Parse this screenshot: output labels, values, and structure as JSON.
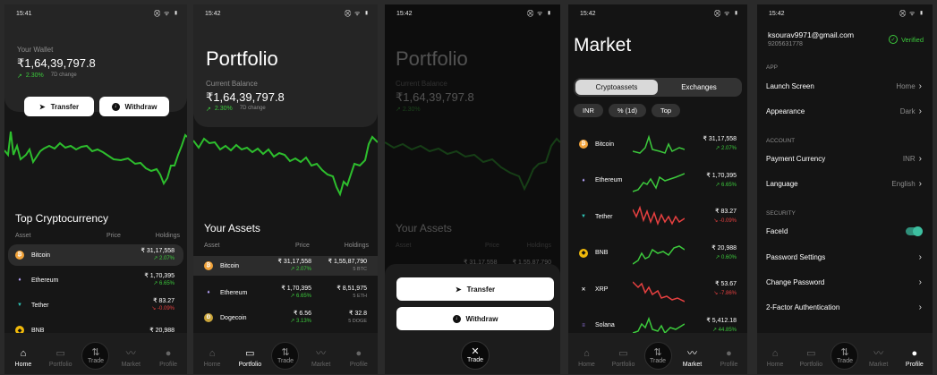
{
  "status_time": "15:42",
  "status_time_first": "15:41",
  "status_right": "⛒ ᯤ ▮",
  "nav": {
    "home": "Home",
    "portfolio": "Portfolio",
    "trade": "Trade",
    "market": "Market",
    "profile": "Profile"
  },
  "home": {
    "wallet_label": "Your Wallet",
    "wallet_value": "₹1,64,39,797.8",
    "wallet_change": "2.30%",
    "wallet_change_period": "7D change",
    "transfer": "Transfer",
    "withdraw": "Withdraw",
    "section_title": "Top Cryptocurrency",
    "col_asset": "Asset",
    "col_price": "Price",
    "col_holdings": "Holdings",
    "rows": [
      {
        "name": "Bitcoin",
        "price": "₹ 31,17,558",
        "change": "2.07%"
      },
      {
        "name": "Ethereum",
        "price": "₹ 1,70,395",
        "change": "6.65%"
      },
      {
        "name": "Tether",
        "price": "₹ 83.27",
        "change": "-0.09%"
      },
      {
        "name": "BNB",
        "price": "₹ 20,988",
        "change": ""
      }
    ]
  },
  "portfolio": {
    "title": "Portfolio",
    "balance_label": "Current Balance",
    "balance_value": "₹1,64,39,797.8",
    "change": "2.30%",
    "change_period": "7D change",
    "section_title": "Your Assets",
    "col_asset": "Asset",
    "col_price": "Price",
    "col_holdings": "Holdings",
    "rows": [
      {
        "name": "Bitcoin",
        "price": "₹ 31,17,558",
        "change": "2.07%",
        "holding": "₹ 1,55,87,790",
        "qty": "5 BTC"
      },
      {
        "name": "Ethereum",
        "price": "₹ 1,70,395",
        "change": "6.65%",
        "holding": "₹ 8,51,975",
        "qty": "5 ETH"
      },
      {
        "name": "Dogecoin",
        "price": "₹ 6.56",
        "change": "3.13%",
        "holding": "₹ 32.8",
        "qty": "5 DOGE"
      }
    ]
  },
  "overlay": {
    "title": "Portfolio",
    "balance_label": "Current Balance",
    "balance_value": "₹1,64,39,797.8",
    "change": "2.30%",
    "section_title": "Your Assets",
    "col_asset": "Asset",
    "col_price": "Price",
    "col_holdings": "Holdings",
    "row_price": "₹ 31,17,558",
    "row_holding": "₹ 1,55,87,790",
    "transfer": "Transfer",
    "withdraw": "Withdraw",
    "trade": "Trade"
  },
  "market": {
    "title": "Market",
    "tabs": [
      "Cryptoassets",
      "Exchanges"
    ],
    "filters": [
      "INR",
      "% (1d)",
      "Top"
    ],
    "rows": [
      {
        "name": "Bitcoin",
        "price": "₹ 31,17,558",
        "change": "2.07%",
        "dir": "up"
      },
      {
        "name": "Ethereum",
        "price": "₹ 1,70,395",
        "change": "6.65%",
        "dir": "up"
      },
      {
        "name": "Tether",
        "price": "₹ 83.27",
        "change": "-0.09%",
        "dir": "down"
      },
      {
        "name": "BNB",
        "price": "₹ 20,988",
        "change": "0.60%",
        "dir": "up"
      },
      {
        "name": "XRP",
        "price": "₹ 53.67",
        "change": "-7.86%",
        "dir": "down"
      },
      {
        "name": "Solana",
        "price": "₹ 5,412.18",
        "change": "44.85%",
        "dir": "up"
      }
    ]
  },
  "profile": {
    "email": "ksourav9971@gmail.com",
    "phone": "9205631778",
    "verified": "Verified",
    "sec_app": "APP",
    "sec_account": "ACCOUNT",
    "sec_security": "SECURITY",
    "launch_screen": "Launch Screen",
    "launch_screen_val": "Home",
    "appearance": "Appearance",
    "appearance_val": "Dark",
    "payment_currency": "Payment Currency",
    "payment_currency_val": "INR",
    "language": "Language",
    "language_val": "English",
    "faceid": "FaceId",
    "password_settings": "Password Settings",
    "change_password": "Change Password",
    "two_factor": "2-Factor Authentication"
  },
  "colors": {
    "green": "#3cc93c",
    "red": "#e64040",
    "bg": "#161616",
    "card": "#252525"
  }
}
